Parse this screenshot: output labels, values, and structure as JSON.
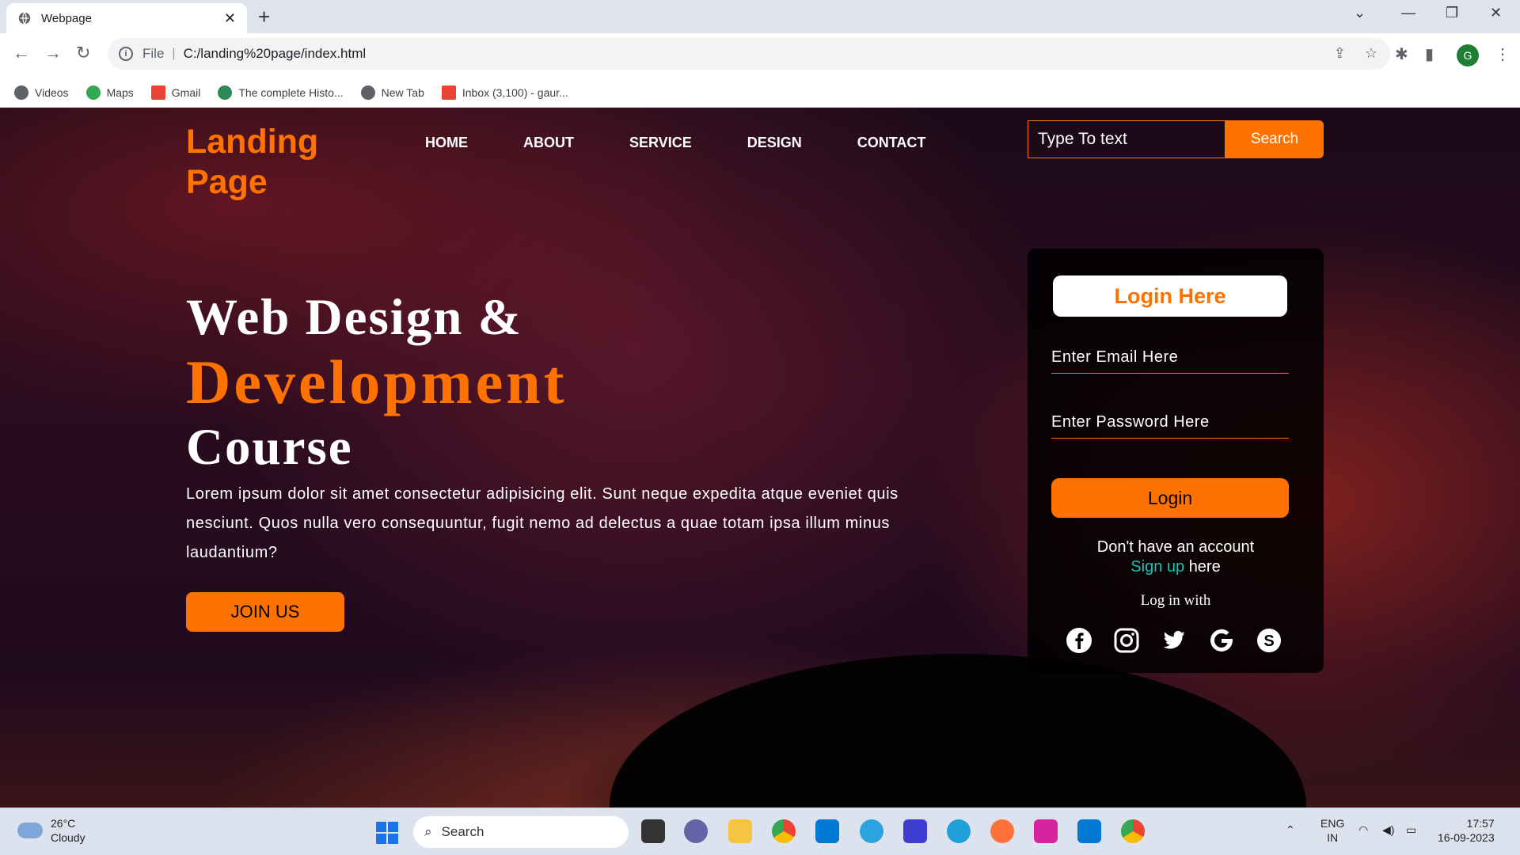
{
  "browser": {
    "tab_title": "Webpage",
    "tab_close": "✕",
    "new_tab": "+",
    "url_scheme": "File",
    "url": "C:/landing%20page/index.html",
    "profile_initial": "G",
    "bookmarks": [
      "Videos",
      "Maps",
      "Gmail",
      "The complete Histo...",
      "New Tab",
      "Inbox (3,100) - gaur..."
    ]
  },
  "site": {
    "logo": "Landing Page",
    "nav": [
      "HOME",
      "ABOUT",
      "SERVICE",
      "DESIGN",
      "CONTACT"
    ],
    "search_placeholder": "Type To text",
    "search_button": "Search",
    "hero": {
      "line1": "Web Design &",
      "line2": "Development",
      "line3": "Course",
      "paragraph": "Lorem ipsum dolor sit amet consectetur adipisicing elit. Sunt neque expedita atque eveniet quis nesciunt. Quos nulla vero consequuntur, fugit nemo ad delectus a quae totam ipsa illum minus laudantium?",
      "join_button": "JOIN US"
    },
    "login": {
      "title": "Login Here",
      "email_placeholder": "Enter Email Here",
      "password_placeholder": "Enter Password Here",
      "button": "Login",
      "no_account": "Don't have an account",
      "signup": "Sign up",
      "signup_suffix": "here",
      "login_with": "Log in with",
      "social": [
        "facebook-icon",
        "instagram-icon",
        "twitter-icon",
        "google-icon",
        "skype-icon"
      ]
    }
  },
  "taskbar": {
    "weather_temp": "26°C",
    "weather_desc": "Cloudy",
    "search_label": "Search",
    "lang": "ENG",
    "region": "IN",
    "time": "17:57",
    "date": "16-09-2023"
  },
  "colors": {
    "accent": "#ff7200",
    "signup": "#17c3b2"
  }
}
